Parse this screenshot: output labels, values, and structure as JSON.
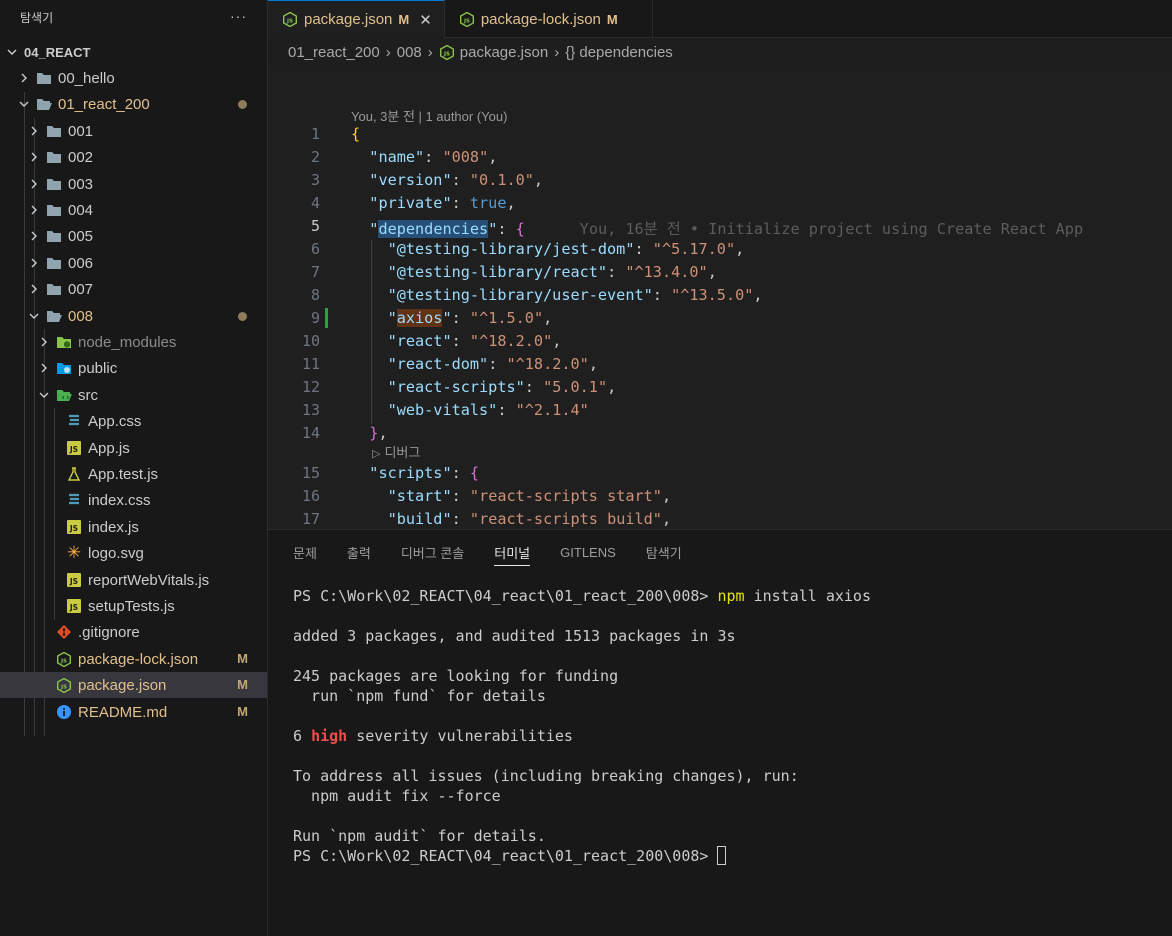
{
  "explorer": {
    "title": "탐색기",
    "more": "···",
    "root": "04_REACT",
    "items": [
      {
        "label": "00_hello"
      },
      {
        "label": "01_react_200"
      },
      {
        "label": "001"
      },
      {
        "label": "002"
      },
      {
        "label": "003"
      },
      {
        "label": "004"
      },
      {
        "label": "005"
      },
      {
        "label": "006"
      },
      {
        "label": "007"
      },
      {
        "label": "008"
      },
      {
        "label": "node_modules"
      },
      {
        "label": "public"
      },
      {
        "label": "src"
      },
      {
        "label": "App.css"
      },
      {
        "label": "App.js"
      },
      {
        "label": "App.test.js"
      },
      {
        "label": "index.css"
      },
      {
        "label": "index.js"
      },
      {
        "label": "logo.svg"
      },
      {
        "label": "reportWebVitals.js"
      },
      {
        "label": "setupTests.js"
      },
      {
        "label": ".gitignore"
      },
      {
        "label": "package-lock.json",
        "status": "M"
      },
      {
        "label": "package.json",
        "status": "M"
      },
      {
        "label": "README.md",
        "status": "M"
      }
    ]
  },
  "tabs": [
    {
      "label": "package.json",
      "status": "M",
      "close": "✕"
    },
    {
      "label": "package-lock.json",
      "status": "M"
    }
  ],
  "breadcrumb": [
    "01_react_200",
    "008",
    "package.json",
    "{} dependencies"
  ],
  "editor": {
    "codelens_blame": "You, 3분 전 | 1 author (You)",
    "codelens_debug": "디버그",
    "inline_blame": "You, 16분 전 • Initialize project using Create React App",
    "line_numbers": [
      "1",
      "2",
      "3",
      "4",
      "5",
      "6",
      "7",
      "8",
      "9",
      "10",
      "11",
      "12",
      "13",
      "14",
      "15",
      "16",
      "17"
    ],
    "json": {
      "name": "008",
      "version": "0.1.0",
      "private": "true",
      "dependencies": [
        {
          "k": "@testing-library/jest-dom",
          "v": "^5.17.0"
        },
        {
          "k": "@testing-library/react",
          "v": "^13.4.0"
        },
        {
          "k": "@testing-library/user-event",
          "v": "^13.5.0"
        },
        {
          "k": "axios",
          "v": "^1.5.0"
        },
        {
          "k": "react",
          "v": "^18.2.0"
        },
        {
          "k": "react-dom",
          "v": "^18.2.0"
        },
        {
          "k": "react-scripts",
          "v": "5.0.1"
        },
        {
          "k": "web-vitals",
          "v": "^2.1.4"
        }
      ],
      "scripts": [
        {
          "k": "start",
          "v": "react-scripts start"
        },
        {
          "k": "build",
          "v": "react-scripts build"
        }
      ]
    }
  },
  "panel": {
    "tabs": [
      "문제",
      "출력",
      "디버그 콘솔",
      "터미널",
      "GITLENS",
      "탐색기"
    ],
    "active_tab": "터미널",
    "terminal": {
      "prompt": "PS C:\\Work\\02_REACT\\04_react\\01_react_200\\008>",
      "cmd_npm": "npm",
      "cmd_rest": "install axios",
      "line_added": "added 3 packages, and audited 1513 packages in 3s",
      "line_funding": "245 packages are looking for funding",
      "line_fund_details": "  run `npm fund` for details",
      "vuln_count": "6",
      "vuln_level": "high",
      "vuln_rest": "severity vulnerabilities",
      "line_address": "To address all issues (including breaking changes), run:",
      "line_fix": "  npm audit fix --force",
      "line_run_audit": "Run `npm audit` for details.",
      "prompt2": "PS C:\\Work\\02_REACT\\04_react\\01_react_200\\008>"
    }
  },
  "colors": {
    "accent": "#0078d4",
    "modified": "#e2c08d",
    "js_icon": "#cbcb41",
    "css_icon": "#519aba",
    "git_icon": "#e44d26",
    "info_icon": "#3794ff"
  }
}
